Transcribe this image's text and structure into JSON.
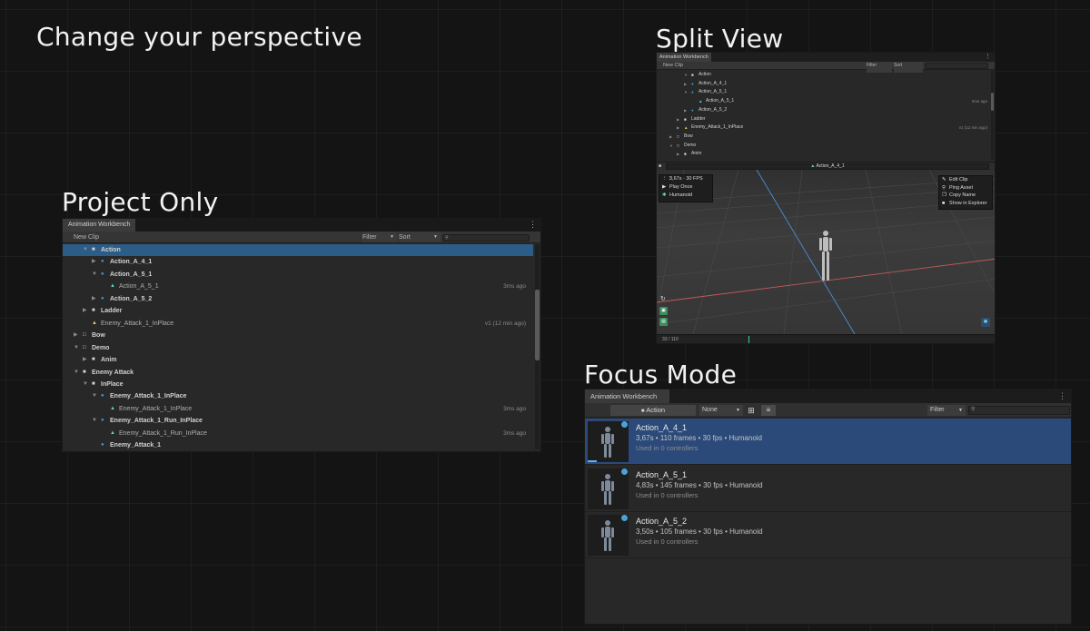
{
  "headings": {
    "change_perspective": "Change your perspective",
    "split_view": "Split View",
    "project_only": "Project Only",
    "focus_mode": "Focus Mode"
  },
  "window_tab": "Animation Workbench",
  "project_only": {
    "new_clip": "New Clip",
    "filter": "Filter",
    "sort": "Sort",
    "tree": [
      {
        "label": "Action",
        "bold": true,
        "meta": ""
      },
      {
        "label": "Action_A_4_1",
        "bold": true,
        "meta": ""
      },
      {
        "label": "Action_A_5_1",
        "bold": true,
        "meta": ""
      },
      {
        "label": "Action_A_5_1",
        "bold": false,
        "meta": "3ms ago"
      },
      {
        "label": "Action_A_5_2",
        "bold": true,
        "meta": ""
      },
      {
        "label": "Ladder",
        "bold": true,
        "meta": ""
      },
      {
        "label": "Enemy_Attack_1_InPlace",
        "bold": false,
        "meta": "v1 (12 min ago)"
      },
      {
        "label": "Bow",
        "bold": true,
        "meta": ""
      },
      {
        "label": "Demo",
        "bold": true,
        "meta": ""
      },
      {
        "label": "Anim",
        "bold": true,
        "meta": ""
      },
      {
        "label": "Enemy Attack",
        "bold": true,
        "meta": ""
      },
      {
        "label": "InPlace",
        "bold": true,
        "meta": ""
      },
      {
        "label": "Enemy_Attack_1_InPlace",
        "bold": true,
        "meta": ""
      },
      {
        "label": "Enemy_Attack_1_InPlace",
        "bold": false,
        "meta": "3ms ago"
      },
      {
        "label": "Enemy_Attack_1_Run_InPlace",
        "bold": true,
        "meta": ""
      },
      {
        "label": "Enemy_Attack_1_Run_InPlace",
        "bold": false,
        "meta": "3ms ago"
      },
      {
        "label": "Enemy_Attack_1",
        "bold": true,
        "meta": ""
      }
    ]
  },
  "split_view": {
    "new_clip": "New Clip",
    "filter": "Filter",
    "sort": "Sort",
    "tree": [
      {
        "label": "Action",
        "meta": ""
      },
      {
        "label": "Action_A_4_1",
        "meta": ""
      },
      {
        "label": "Action_A_5_1",
        "meta": ""
      },
      {
        "label": "Action_A_5_1",
        "meta": "3ms ago"
      },
      {
        "label": "Action_A_5_2",
        "meta": ""
      },
      {
        "label": "Ladder",
        "meta": ""
      },
      {
        "label": "Enemy_Attack_1_InPlace",
        "meta": "v1 (12 min ago)"
      },
      {
        "label": "Bow",
        "meta": ""
      },
      {
        "label": "Demo",
        "meta": ""
      },
      {
        "label": "Anim",
        "meta": ""
      }
    ],
    "preview_clip": "Action_A_4_1",
    "info": [
      "3,67s · 30 FPS",
      "Play Once",
      "Humanoid"
    ],
    "context_menu": [
      "Edit Clip",
      "Ping Asset",
      "Copy Name",
      "Show in Explorer"
    ],
    "frame_counter": "33 / 110"
  },
  "focus_mode": {
    "folder": "Action",
    "none": "None",
    "filter": "Filter",
    "clips": [
      {
        "name": "Action_A_4_1",
        "info": "3,67s • 110 frames • 30 fps • Humanoid",
        "used": "Used in 0 controllers"
      },
      {
        "name": "Action_A_5_1",
        "info": "4,83s • 145 frames • 30 fps • Humanoid",
        "used": "Used in 0 controllers"
      },
      {
        "name": "Action_A_5_2",
        "info": "3,50s • 105 frames • 30 fps • Humanoid",
        "used": "Used in 0 controllers"
      }
    ]
  },
  "icons": {
    "kebab": "⋮",
    "arrow_down": "▼",
    "arrow_right": "▶",
    "search": "🔍",
    "folder": "■"
  }
}
